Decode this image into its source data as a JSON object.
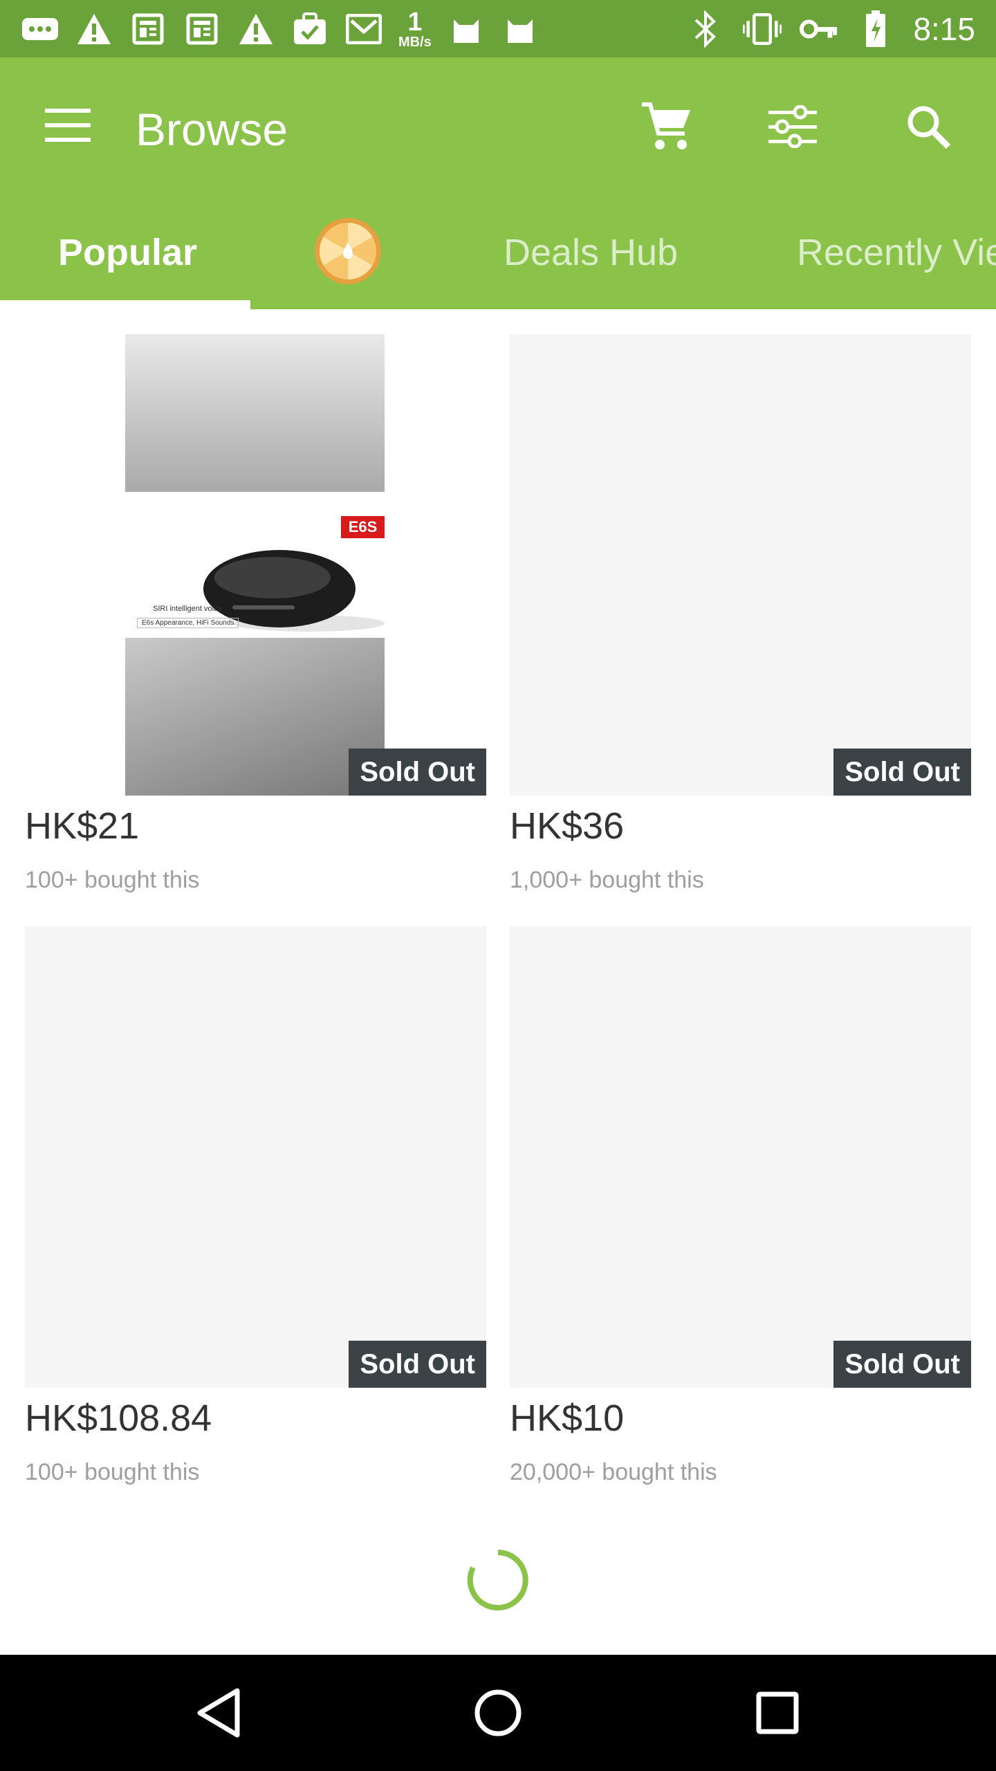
{
  "status_bar": {
    "speed_value": "1",
    "speed_unit": "MB/s",
    "time": "8:15"
  },
  "app_bar": {
    "title": "Browse",
    "icons": [
      "menu-icon",
      "cart-icon",
      "filter-icon",
      "search-icon"
    ]
  },
  "tabs": [
    {
      "label": "Popular",
      "active": true
    },
    {
      "label": "Deals Hub",
      "active": false
    },
    {
      "label": "Recently Viewed",
      "active": false
    }
  ],
  "products": [
    {
      "price": "HK$21",
      "bought": "100+ bought this",
      "badge": "Sold Out",
      "image_text": [
        "E6S",
        "SIRI intelligent voice",
        "E6s Appearance, HiFi Sounds"
      ]
    },
    {
      "price": "HK$36",
      "bought": "1,000+ bought this",
      "badge": "Sold Out"
    },
    {
      "price": "HK$108.84",
      "bought": "100+ bought this",
      "badge": "Sold Out"
    },
    {
      "price": "HK$10",
      "bought": "20,000+ bought this",
      "badge": "Sold Out"
    }
  ],
  "colors": {
    "status_bar": "#6aa33a",
    "app_bar": "#8bc34a",
    "sold_out_bg": "#3b4347",
    "spinner": "#8bc34a"
  }
}
